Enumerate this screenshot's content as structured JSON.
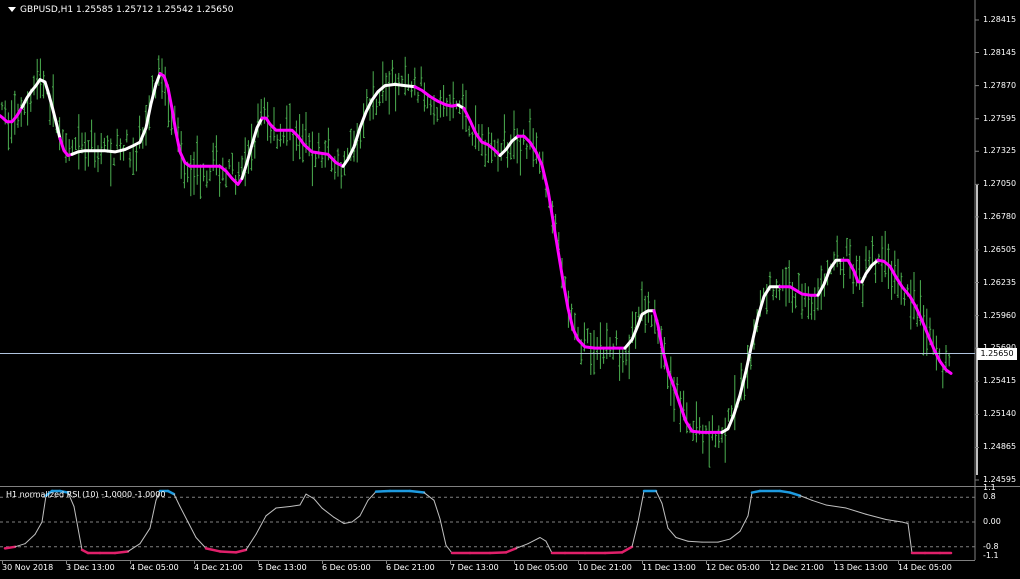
{
  "window": {
    "symbol_header": "GBPUSD,H1  1.25585 1.25712 1.25542 1.25650",
    "current_price": "1.25650"
  },
  "indicator": {
    "title": "H1 normalized RSI (10) -1.0000 -1.0000"
  },
  "colors": {
    "background": "#000000",
    "candles": "#4caf50",
    "ma_up": "#ffffff",
    "ma_down": "#ff00ff",
    "rsi_line": "#c0c0c0",
    "rsi_top": "#1e9be0",
    "rsi_bottom": "#e0206a",
    "grid": "#808080"
  },
  "price_axis": [
    "1.28415",
    "1.28145",
    "1.27870",
    "1.27595",
    "1.27325",
    "1.27050",
    "1.26780",
    "1.26505",
    "1.26235",
    "1.25960",
    "1.25690",
    "1.25415",
    "1.25140",
    "1.24865",
    "1.24595"
  ],
  "rsi_axis": [
    "1.1",
    "0.8",
    "0.00",
    "-0.8",
    "-1.1"
  ],
  "time_axis": [
    "30 Nov 2018",
    "3 Dec 13:00",
    "4 Dec 05:00",
    "4 Dec 21:00",
    "5 Dec 13:00",
    "6 Dec 05:00",
    "6 Dec 21:00",
    "7 Dec 13:00",
    "10 Dec 05:00",
    "10 Dec 21:00",
    "11 Dec 13:00",
    "12 Dec 05:00",
    "12 Dec 21:00",
    "13 Dec 13:00",
    "14 Dec 05:00"
  ],
  "chart_data": {
    "type": "line",
    "price_ticks": [
      1.28415,
      1.28145,
      1.2787,
      1.27595,
      1.27325,
      1.2705,
      1.2678,
      1.26505,
      1.26235,
      1.2596,
      1.2569,
      1.25415,
      1.2514,
      1.24865,
      1.24595
    ],
    "current_price": 1.2565,
    "ma_series": [
      [
        0,
        1.2762
      ],
      [
        3,
        1.276
      ],
      [
        7,
        1.2757
      ],
      [
        12,
        1.2757
      ],
      [
        17,
        1.2762
      ],
      [
        22,
        1.2769
      ],
      [
        27,
        1.2777
      ],
      [
        32,
        1.2783
      ],
      [
        36,
        1.2787
      ],
      [
        40,
        1.2792
      ],
      [
        45,
        1.279
      ],
      [
        48,
        1.2782
      ],
      [
        52,
        1.277
      ],
      [
        56,
        1.2757
      ],
      [
        60,
        1.2743
      ],
      [
        64,
        1.2733
      ],
      [
        68,
        1.2729
      ],
      [
        72,
        1.273
      ],
      [
        78,
        1.2732
      ],
      [
        85,
        1.2733
      ],
      [
        95,
        1.2733
      ],
      [
        105,
        1.2733
      ],
      [
        115,
        1.2732
      ],
      [
        125,
        1.2734
      ],
      [
        133,
        1.2737
      ],
      [
        140,
        1.274
      ],
      [
        146,
        1.2752
      ],
      [
        151,
        1.2772
      ],
      [
        156,
        1.2788
      ],
      [
        160,
        1.2797
      ],
      [
        164,
        1.2795
      ],
      [
        168,
        1.2785
      ],
      [
        172,
        1.2768
      ],
      [
        176,
        1.2748
      ],
      [
        180,
        1.2732
      ],
      [
        185,
        1.2723
      ],
      [
        190,
        1.272
      ],
      [
        200,
        1.272
      ],
      [
        210,
        1.272
      ],
      [
        220,
        1.272
      ],
      [
        226,
        1.2716
      ],
      [
        232,
        1.271
      ],
      [
        238,
        1.2705
      ],
      [
        242,
        1.271
      ],
      [
        247,
        1.2723
      ],
      [
        252,
        1.2738
      ],
      [
        257,
        1.2752
      ],
      [
        262,
        1.276
      ],
      [
        266,
        1.276
      ],
      [
        270,
        1.2755
      ],
      [
        276,
        1.275
      ],
      [
        284,
        1.275
      ],
      [
        292,
        1.275
      ],
      [
        298,
        1.2745
      ],
      [
        304,
        1.2738
      ],
      [
        312,
        1.2732
      ],
      [
        320,
        1.2731
      ],
      [
        328,
        1.273
      ],
      [
        336,
        1.2723
      ],
      [
        343,
        1.272
      ],
      [
        348,
        1.2726
      ],
      [
        354,
        1.2736
      ],
      [
        360,
        1.2752
      ],
      [
        366,
        1.2765
      ],
      [
        372,
        1.2775
      ],
      [
        378,
        1.2782
      ],
      [
        385,
        1.2787
      ],
      [
        395,
        1.2788
      ],
      [
        405,
        1.2787
      ],
      [
        415,
        1.2786
      ],
      [
        422,
        1.2783
      ],
      [
        430,
        1.2778
      ],
      [
        438,
        1.2774
      ],
      [
        446,
        1.2771
      ],
      [
        452,
        1.277
      ],
      [
        458,
        1.2771
      ],
      [
        464,
        1.2768
      ],
      [
        470,
        1.2758
      ],
      [
        476,
        1.2747
      ],
      [
        482,
        1.274
      ],
      [
        488,
        1.2738
      ],
      [
        494,
        1.2734
      ],
      [
        500,
        1.2729
      ],
      [
        506,
        1.2734
      ],
      [
        512,
        1.2741
      ],
      [
        518,
        1.2745
      ],
      [
        524,
        1.2745
      ],
      [
        530,
        1.274
      ],
      [
        536,
        1.2732
      ],
      [
        542,
        1.2721
      ],
      [
        548,
        1.27
      ],
      [
        553,
        1.2675
      ],
      [
        558,
        1.265
      ],
      [
        563,
        1.2625
      ],
      [
        568,
        1.2602
      ],
      [
        573,
        1.2585
      ],
      [
        578,
        1.2576
      ],
      [
        585,
        1.257
      ],
      [
        595,
        1.2569
      ],
      [
        605,
        1.2569
      ],
      [
        615,
        1.2569
      ],
      [
        625,
        1.2569
      ],
      [
        632,
        1.2576
      ],
      [
        638,
        1.2588
      ],
      [
        642,
        1.2597
      ],
      [
        648,
        1.26
      ],
      [
        654,
        1.26
      ],
      [
        658,
        1.2588
      ],
      [
        662,
        1.257
      ],
      [
        668,
        1.255
      ],
      [
        674,
        1.2537
      ],
      [
        680,
        1.2522
      ],
      [
        686,
        1.2508
      ],
      [
        692,
        1.25
      ],
      [
        702,
        1.2499
      ],
      [
        712,
        1.2499
      ],
      [
        722,
        1.2499
      ],
      [
        728,
        1.2502
      ],
      [
        734,
        1.2514
      ],
      [
        740,
        1.253
      ],
      [
        746,
        1.255
      ],
      [
        752,
        1.2573
      ],
      [
        758,
        1.2595
      ],
      [
        764,
        1.2612
      ],
      [
        770,
        1.262
      ],
      [
        780,
        1.262
      ],
      [
        790,
        1.262
      ],
      [
        796,
        1.2617
      ],
      [
        802,
        1.2614
      ],
      [
        810,
        1.2613
      ],
      [
        818,
        1.2613
      ],
      [
        824,
        1.2622
      ],
      [
        830,
        1.2635
      ],
      [
        836,
        1.2642
      ],
      [
        842,
        1.2642
      ],
      [
        848,
        1.2642
      ],
      [
        854,
        1.2633
      ],
      [
        858,
        1.2624
      ],
      [
        862,
        1.2624
      ],
      [
        866,
        1.2631
      ],
      [
        872,
        1.2638
      ],
      [
        878,
        1.2642
      ],
      [
        884,
        1.2641
      ],
      [
        890,
        1.2637
      ],
      [
        896,
        1.2628
      ],
      [
        902,
        1.262
      ],
      [
        910,
        1.2612
      ],
      [
        916,
        1.2603
      ],
      [
        922,
        1.2592
      ],
      [
        928,
        1.258
      ],
      [
        934,
        1.2568
      ],
      [
        940,
        1.2558
      ],
      [
        946,
        1.2551
      ],
      [
        951,
        1.2548
      ]
    ],
    "ma_segments": [
      {
        "from": 0,
        "to": 22,
        "color": "ma_down"
      },
      {
        "from": 22,
        "to": 60,
        "color": "ma_up"
      },
      {
        "from": 60,
        "to": 72,
        "color": "ma_down"
      },
      {
        "from": 72,
        "to": 140,
        "color": "ma_up"
      },
      {
        "from": 140,
        "to": 160,
        "color": "ma_up"
      },
      {
        "from": 160,
        "to": 242,
        "color": "ma_down"
      },
      {
        "from": 242,
        "to": 262,
        "color": "ma_up"
      },
      {
        "from": 262,
        "to": 343,
        "color": "ma_down"
      },
      {
        "from": 343,
        "to": 415,
        "color": "ma_up"
      },
      {
        "from": 415,
        "to": 458,
        "color": "ma_down"
      },
      {
        "from": 458,
        "to": 464,
        "color": "ma_up"
      },
      {
        "from": 464,
        "to": 500,
        "color": "ma_down"
      },
      {
        "from": 500,
        "to": 518,
        "color": "ma_up"
      },
      {
        "from": 518,
        "to": 625,
        "color": "ma_down"
      },
      {
        "from": 625,
        "to": 654,
        "color": "ma_up"
      },
      {
        "from": 654,
        "to": 722,
        "color": "ma_down"
      },
      {
        "from": 722,
        "to": 780,
        "color": "ma_up"
      },
      {
        "from": 780,
        "to": 818,
        "color": "ma_down"
      },
      {
        "from": 818,
        "to": 842,
        "color": "ma_up"
      },
      {
        "from": 842,
        "to": 862,
        "color": "ma_down"
      },
      {
        "from": 862,
        "to": 878,
        "color": "ma_up"
      },
      {
        "from": 878,
        "to": 951,
        "color": "ma_down"
      }
    ],
    "rsi_levels": [
      1.1,
      0.8,
      0.0,
      -0.8,
      -1.1
    ],
    "rsi_series": [
      [
        5,
        -0.85
      ],
      [
        15,
        -0.8
      ],
      [
        25,
        -0.7
      ],
      [
        35,
        -0.4
      ],
      [
        42,
        0.0
      ],
      [
        46,
        0.85
      ],
      [
        52,
        1.0
      ],
      [
        60,
        1.0
      ],
      [
        68,
        0.95
      ],
      [
        74,
        0.5
      ],
      [
        78,
        -0.2
      ],
      [
        82,
        -0.9
      ],
      [
        88,
        -1.0
      ],
      [
        100,
        -1.0
      ],
      [
        115,
        -1.0
      ],
      [
        128,
        -0.95
      ],
      [
        140,
        -0.7
      ],
      [
        150,
        -0.2
      ],
      [
        156,
        0.7
      ],
      [
        160,
        1.0
      ],
      [
        168,
        1.0
      ],
      [
        174,
        0.9
      ],
      [
        180,
        0.5
      ],
      [
        188,
        0.0
      ],
      [
        196,
        -0.5
      ],
      [
        206,
        -0.85
      ],
      [
        220,
        -0.95
      ],
      [
        236,
        -0.98
      ],
      [
        246,
        -0.9
      ],
      [
        256,
        -0.4
      ],
      [
        266,
        0.2
      ],
      [
        276,
        0.45
      ],
      [
        290,
        0.5
      ],
      [
        300,
        0.55
      ],
      [
        306,
        0.9
      ],
      [
        314,
        0.75
      ],
      [
        322,
        0.45
      ],
      [
        334,
        0.15
      ],
      [
        344,
        -0.05
      ],
      [
        352,
        0.0
      ],
      [
        360,
        0.2
      ],
      [
        368,
        0.7
      ],
      [
        376,
        0.98
      ],
      [
        390,
        1.0
      ],
      [
        410,
        1.0
      ],
      [
        424,
        0.95
      ],
      [
        434,
        0.7
      ],
      [
        440,
        0.1
      ],
      [
        446,
        -0.75
      ],
      [
        452,
        -1.0
      ],
      [
        470,
        -1.0
      ],
      [
        490,
        -1.0
      ],
      [
        506,
        -0.98
      ],
      [
        516,
        -0.85
      ],
      [
        528,
        -0.7
      ],
      [
        540,
        -0.5
      ],
      [
        546,
        -0.62
      ],
      [
        552,
        -1.0
      ],
      [
        565,
        -1.0
      ],
      [
        585,
        -1.0
      ],
      [
        605,
        -1.0
      ],
      [
        622,
        -0.98
      ],
      [
        632,
        -0.8
      ],
      [
        638,
        0.0
      ],
      [
        644,
        1.0
      ],
      [
        656,
        1.0
      ],
      [
        662,
        0.6
      ],
      [
        668,
        -0.2
      ],
      [
        676,
        -0.5
      ],
      [
        688,
        -0.62
      ],
      [
        702,
        -0.65
      ],
      [
        718,
        -0.65
      ],
      [
        730,
        -0.55
      ],
      [
        740,
        -0.3
      ],
      [
        748,
        0.2
      ],
      [
        752,
        0.95
      ],
      [
        760,
        1.0
      ],
      [
        780,
        1.0
      ],
      [
        790,
        0.95
      ],
      [
        800,
        0.85
      ],
      [
        812,
        0.7
      ],
      [
        826,
        0.55
      ],
      [
        846,
        0.45
      ],
      [
        866,
        0.25
      ],
      [
        886,
        0.08
      ],
      [
        902,
        0.0
      ],
      [
        908,
        -0.05
      ],
      [
        912,
        -1.0
      ],
      [
        925,
        -1.0
      ],
      [
        940,
        -1.0
      ],
      [
        951,
        -1.0
      ]
    ]
  }
}
